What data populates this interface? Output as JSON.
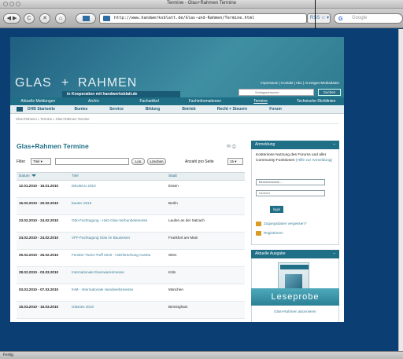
{
  "window": {
    "title": "Termine - Glas+Rahmen Termine"
  },
  "toolbar": {
    "back": "◀",
    "forward": "▶",
    "reload": "C",
    "stop": "✕",
    "home": "⌂",
    "url": "http://www.handwerksblatt.de/Glas-und-Rahmen/Termine.html",
    "rss": "RSS ☆ ▾",
    "search_placeholder": "Google"
  },
  "site": {
    "logo_glas": "GLAS",
    "logo_plus": "+",
    "logo_rahmen": "RAHMEN",
    "koop": "in Kooperation mit handwerksblatt.de",
    "toplinks": "Impressum | Kontakt | Abo | Anzeigen-Mediadaten",
    "search_placeholder": "Schlagwortsuche",
    "search_button": "Suchen"
  },
  "mainnav": [
    "Aktuelle Meldungen",
    "Archiv",
    "Fachartikel",
    "Fachinformationen",
    "Termine",
    "Technische Richtlinien"
  ],
  "subnav": [
    "DHB Startseite",
    "Buntes",
    "Service",
    "Bildung",
    "Betrieb",
    "Recht + Steuern",
    "Forum"
  ],
  "breadcrumb": [
    "Glas+Rahmen",
    "Termine",
    "Glas+Rahmen Termine"
  ],
  "content": {
    "title": "Glas+Rahmen Termine",
    "page_icons": "✉ ⎙",
    "filter_label": "Filter",
    "filter_select": "Titel",
    "los": "Los",
    "loeschen": "Löschen",
    "per_page_label": "Anzahl pro Seite",
    "per_page_value": "15"
  },
  "table": {
    "headers": [
      "Datum",
      "Titel",
      "Stadt"
    ],
    "rows": [
      {
        "date": "12.01.2010 - 16.01.2010",
        "title": "DEUBAU 2010",
        "city": "Essen"
      },
      {
        "date": "16.02.2010 - 20.02.2010",
        "title": "bautec 2010",
        "city": "Berlin"
      },
      {
        "date": "23.02.2010 - 24.02.2010",
        "title": "Otto-Fachtagung - Holz-Glas-Verbundelemente",
        "city": "Laufen an der Salzach"
      },
      {
        "date": "24.02.2010 - 24.02.2010",
        "title": "VFF-Fachtagung Glas im Bauwesen",
        "city": "Frankfurt am Main"
      },
      {
        "date": "25.02.2010 - 26.02.2010",
        "title": "Fenster-Türen-Treff 2010 - Holzforschung Austria",
        "city": "Wien"
      },
      {
        "date": "28.02.2010 - 03.03.2010",
        "title": "Internationale Eisenwarenmesse",
        "city": "Köln"
      },
      {
        "date": "03.03.2010 - 07.03.2010",
        "title": "IHM - Internationale Handwerksmesse",
        "city": "München"
      },
      {
        "date": "15.03.2010 - 16.03.2010",
        "title": "Glassex 2010",
        "city": "Birmingham"
      },
      {
        "date": "24.03.2010 - ",
        "title": "fensterbau/frontale",
        "city": "Nürnberg"
      }
    ]
  },
  "sidebar": {
    "login_title": "Anmeldung",
    "login_text": "Kostenlose Nutzung des Forums und aller Community-Funktionen",
    "login_link": "(Hilfe zur Anmeldung)",
    "username_placeholder": "Benutzername ...",
    "password_value": "••••••••••",
    "login_button": "login",
    "forgot": "Zugangsdaten vergessen?",
    "register": "Registrieren",
    "issue_title": "Aktuelle Ausgabe",
    "issue_link": "Glas+Rahmen abonnieren",
    "leseprobe": "Leseprobe"
  },
  "status": {
    "text": "Fertig"
  }
}
